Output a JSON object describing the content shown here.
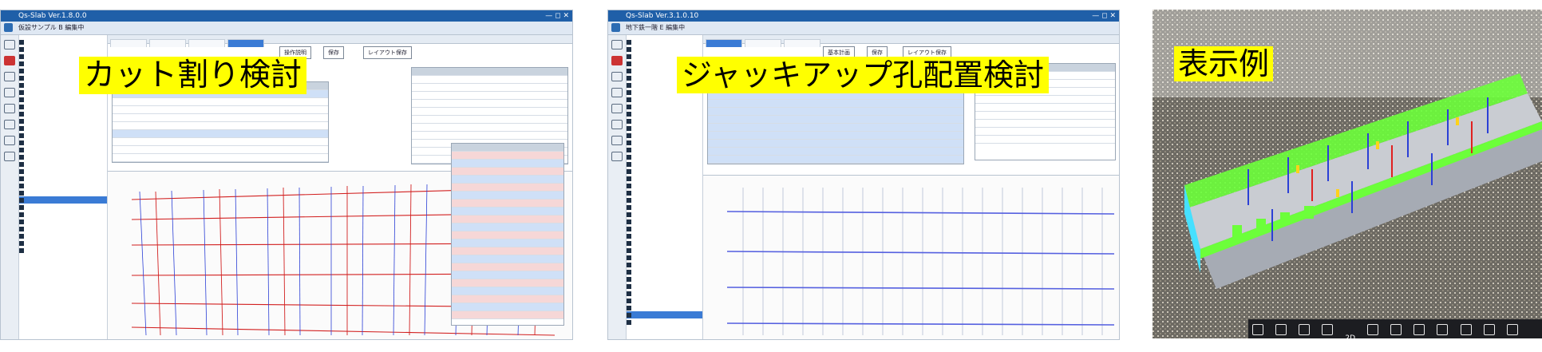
{
  "screens": [
    {
      "window_title": "Qs-Slab Ver.1.8.0.0",
      "file_name": "仮設サンプル B 編集中",
      "caption": "カット割り検討",
      "buttons": [
        "操作説明",
        "保存",
        "レイアウト保存"
      ]
    },
    {
      "window_title": "Qs-Slab Ver.3.1.0.10",
      "file_name": "地下鉄一階 E 編集中",
      "caption": "ジャッキアップ孔配置検討",
      "buttons": [
        "基本計画",
        "保存",
        "レイアウト保存"
      ]
    }
  ],
  "example": {
    "caption": "表示例",
    "toolbar_mode": "2D"
  },
  "colors": {
    "caption_bg": "#ffff00",
    "title_bar": "#1f5fa8",
    "red_line": "#d22020",
    "blue_line": "#2b3fd6",
    "slab_green": "#6cff3a"
  }
}
